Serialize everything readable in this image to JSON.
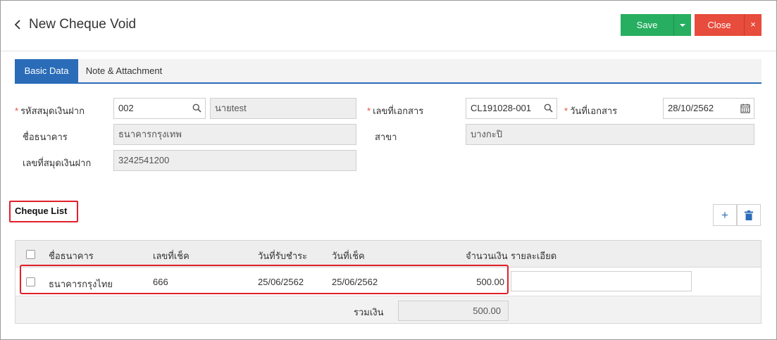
{
  "header": {
    "title": "New Cheque Void",
    "save_label": "Save",
    "close_label": "Close"
  },
  "tabs": [
    {
      "label": "Basic Data",
      "active": true
    },
    {
      "label": "Note & Attachment",
      "active": false
    }
  ],
  "form": {
    "passbook_code_label": "รหัสสมุดเงินฝาก",
    "passbook_code_value": "002",
    "passbook_name_value": "นายtest",
    "bank_name_label": "ชื่อธนาคาร",
    "bank_name_value": "ธนาคารกรุงเทพ",
    "account_no_label": "เลขที่สมุดเงินฝาก",
    "account_no_value": "3242541200",
    "doc_no_label": "เลขที่เอกสาร",
    "doc_no_value": "CL191028-001",
    "doc_date_label": "วันที่เอกสาร",
    "doc_date_value": "28/10/2562",
    "branch_label": "สาขา",
    "branch_value": "บางกะปิ"
  },
  "cheque_list": {
    "title": "Cheque List",
    "columns": [
      "ชื่อธนาคาร",
      "เลขที่เช็ค",
      "วันที่รับชำระ",
      "วันที่เช็ค",
      "จำนวนเงิน",
      "รายละเอียด"
    ],
    "rows": [
      {
        "bank": "ธนาคารกรุงไทย",
        "cheque_no": "666",
        "receive_date": "25/06/2562",
        "cheque_date": "25/06/2562",
        "amount": "500.00",
        "detail": ""
      }
    ],
    "total_label": "รวมเงิน",
    "total_value": "500.00"
  },
  "colors": {
    "save": "#27ae60",
    "close": "#e74c3c",
    "active_tab": "#2b6cb8",
    "highlight": "#e0202a"
  }
}
